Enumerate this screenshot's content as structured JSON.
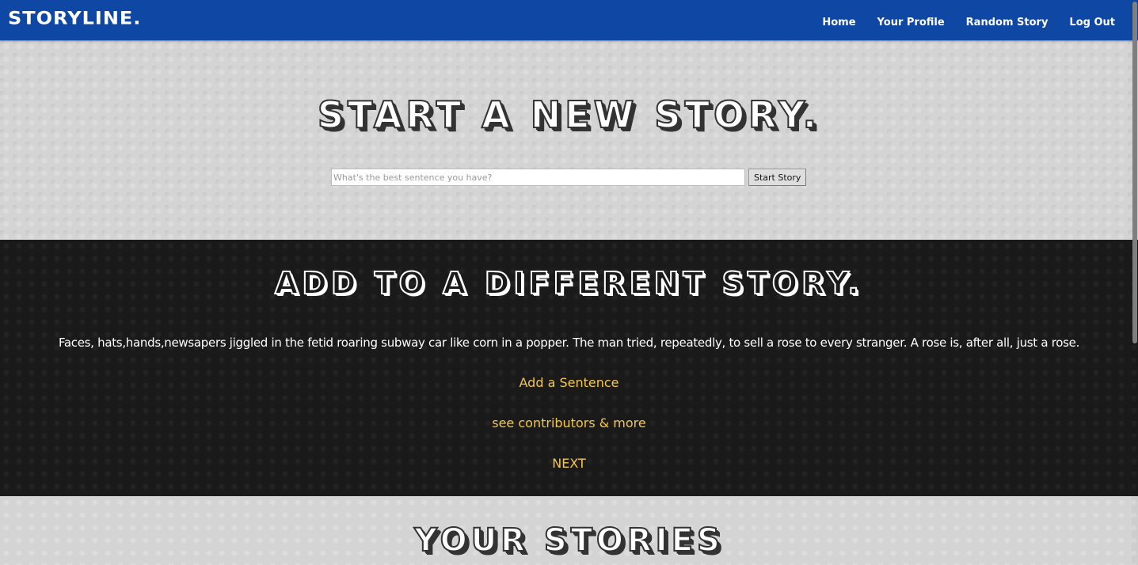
{
  "navbar": {
    "logo": "STORYLINE.",
    "links": [
      "Home",
      "Your Profile",
      "Random Story",
      "Log Out"
    ]
  },
  "new_story": {
    "heading": "START A NEW STORY.",
    "input_placeholder": "What's the best sentence you have?",
    "button_label": "Start Story"
  },
  "add_story": {
    "heading": "ADD TO A DIFFERENT STORY.",
    "story_text": "Faces, hats,hands,newsapers jiggled in the fetid roaring subway car like corn in a popper. The man tried, repeatedly, to sell a rose to every stranger. A rose is, after all, just a rose.",
    "add_sentence_label": "Add a Sentence",
    "contributors_label": "see contributors & more",
    "next_label": "NEXT"
  },
  "your_stories": {
    "heading": "YOUR STORIES"
  },
  "colors": {
    "navbar": "#0f47a4",
    "link_accent": "#f3c74c",
    "dark_section": "#1a1a1a",
    "light_section": "#d4d4d4"
  }
}
